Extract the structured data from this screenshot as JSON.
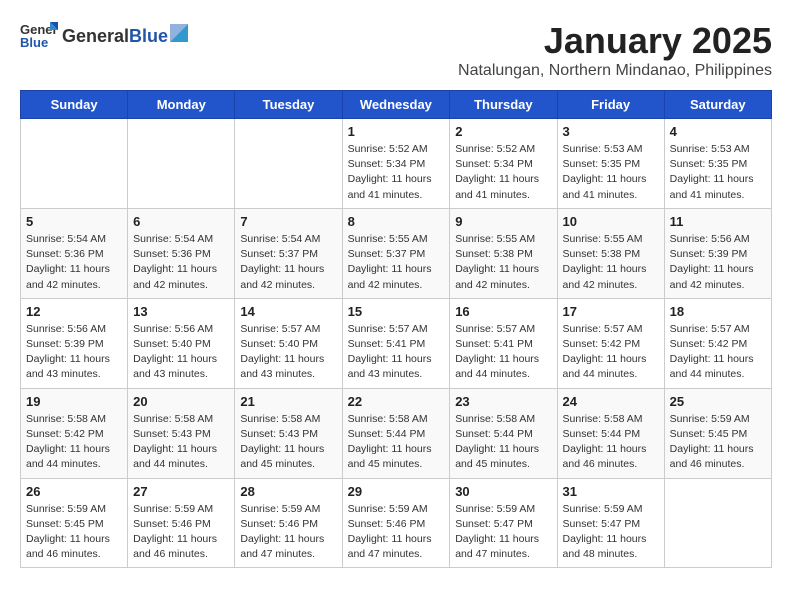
{
  "header": {
    "logo": {
      "general": "General",
      "blue": "Blue"
    },
    "title": "January 2025",
    "location": "Natalungan, Northern Mindanao, Philippines"
  },
  "calendar": {
    "days_of_week": [
      "Sunday",
      "Monday",
      "Tuesday",
      "Wednesday",
      "Thursday",
      "Friday",
      "Saturday"
    ],
    "weeks": [
      [
        {
          "day": "",
          "info": ""
        },
        {
          "day": "",
          "info": ""
        },
        {
          "day": "",
          "info": ""
        },
        {
          "day": "1",
          "info": "Sunrise: 5:52 AM\nSunset: 5:34 PM\nDaylight: 11 hours\nand 41 minutes."
        },
        {
          "day": "2",
          "info": "Sunrise: 5:52 AM\nSunset: 5:34 PM\nDaylight: 11 hours\nand 41 minutes."
        },
        {
          "day": "3",
          "info": "Sunrise: 5:53 AM\nSunset: 5:35 PM\nDaylight: 11 hours\nand 41 minutes."
        },
        {
          "day": "4",
          "info": "Sunrise: 5:53 AM\nSunset: 5:35 PM\nDaylight: 11 hours\nand 41 minutes."
        }
      ],
      [
        {
          "day": "5",
          "info": "Sunrise: 5:54 AM\nSunset: 5:36 PM\nDaylight: 11 hours\nand 42 minutes."
        },
        {
          "day": "6",
          "info": "Sunrise: 5:54 AM\nSunset: 5:36 PM\nDaylight: 11 hours\nand 42 minutes."
        },
        {
          "day": "7",
          "info": "Sunrise: 5:54 AM\nSunset: 5:37 PM\nDaylight: 11 hours\nand 42 minutes."
        },
        {
          "day": "8",
          "info": "Sunrise: 5:55 AM\nSunset: 5:37 PM\nDaylight: 11 hours\nand 42 minutes."
        },
        {
          "day": "9",
          "info": "Sunrise: 5:55 AM\nSunset: 5:38 PM\nDaylight: 11 hours\nand 42 minutes."
        },
        {
          "day": "10",
          "info": "Sunrise: 5:55 AM\nSunset: 5:38 PM\nDaylight: 11 hours\nand 42 minutes."
        },
        {
          "day": "11",
          "info": "Sunrise: 5:56 AM\nSunset: 5:39 PM\nDaylight: 11 hours\nand 42 minutes."
        }
      ],
      [
        {
          "day": "12",
          "info": "Sunrise: 5:56 AM\nSunset: 5:39 PM\nDaylight: 11 hours\nand 43 minutes."
        },
        {
          "day": "13",
          "info": "Sunrise: 5:56 AM\nSunset: 5:40 PM\nDaylight: 11 hours\nand 43 minutes."
        },
        {
          "day": "14",
          "info": "Sunrise: 5:57 AM\nSunset: 5:40 PM\nDaylight: 11 hours\nand 43 minutes."
        },
        {
          "day": "15",
          "info": "Sunrise: 5:57 AM\nSunset: 5:41 PM\nDaylight: 11 hours\nand 43 minutes."
        },
        {
          "day": "16",
          "info": "Sunrise: 5:57 AM\nSunset: 5:41 PM\nDaylight: 11 hours\nand 44 minutes."
        },
        {
          "day": "17",
          "info": "Sunrise: 5:57 AM\nSunset: 5:42 PM\nDaylight: 11 hours\nand 44 minutes."
        },
        {
          "day": "18",
          "info": "Sunrise: 5:57 AM\nSunset: 5:42 PM\nDaylight: 11 hours\nand 44 minutes."
        }
      ],
      [
        {
          "day": "19",
          "info": "Sunrise: 5:58 AM\nSunset: 5:42 PM\nDaylight: 11 hours\nand 44 minutes."
        },
        {
          "day": "20",
          "info": "Sunrise: 5:58 AM\nSunset: 5:43 PM\nDaylight: 11 hours\nand 44 minutes."
        },
        {
          "day": "21",
          "info": "Sunrise: 5:58 AM\nSunset: 5:43 PM\nDaylight: 11 hours\nand 45 minutes."
        },
        {
          "day": "22",
          "info": "Sunrise: 5:58 AM\nSunset: 5:44 PM\nDaylight: 11 hours\nand 45 minutes."
        },
        {
          "day": "23",
          "info": "Sunrise: 5:58 AM\nSunset: 5:44 PM\nDaylight: 11 hours\nand 45 minutes."
        },
        {
          "day": "24",
          "info": "Sunrise: 5:58 AM\nSunset: 5:44 PM\nDaylight: 11 hours\nand 46 minutes."
        },
        {
          "day": "25",
          "info": "Sunrise: 5:59 AM\nSunset: 5:45 PM\nDaylight: 11 hours\nand 46 minutes."
        }
      ],
      [
        {
          "day": "26",
          "info": "Sunrise: 5:59 AM\nSunset: 5:45 PM\nDaylight: 11 hours\nand 46 minutes."
        },
        {
          "day": "27",
          "info": "Sunrise: 5:59 AM\nSunset: 5:46 PM\nDaylight: 11 hours\nand 46 minutes."
        },
        {
          "day": "28",
          "info": "Sunrise: 5:59 AM\nSunset: 5:46 PM\nDaylight: 11 hours\nand 47 minutes."
        },
        {
          "day": "29",
          "info": "Sunrise: 5:59 AM\nSunset: 5:46 PM\nDaylight: 11 hours\nand 47 minutes."
        },
        {
          "day": "30",
          "info": "Sunrise: 5:59 AM\nSunset: 5:47 PM\nDaylight: 11 hours\nand 47 minutes."
        },
        {
          "day": "31",
          "info": "Sunrise: 5:59 AM\nSunset: 5:47 PM\nDaylight: 11 hours\nand 48 minutes."
        },
        {
          "day": "",
          "info": ""
        }
      ]
    ]
  }
}
